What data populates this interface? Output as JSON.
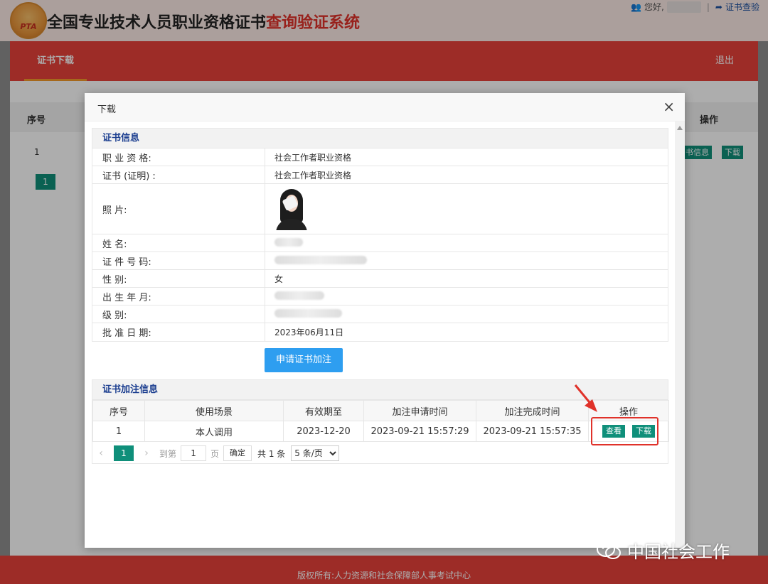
{
  "header": {
    "logo_text": "PTA",
    "title_main": "全国专业技术人员职业资格证书",
    "title_accent": "查询验证系统",
    "greeting": "您好,",
    "sep": "|",
    "verify_link": "证书查验"
  },
  "nav": {
    "active_item": "证书下载",
    "logout": "退出"
  },
  "background_table": {
    "headers": [
      "序号",
      "操作"
    ],
    "row": {
      "index": "1",
      "btn_info": "书信息",
      "btn_download": "下载"
    },
    "pager": {
      "current": "1"
    }
  },
  "modal": {
    "title": "下载",
    "close": "×",
    "cert_section": {
      "heading": "证书信息",
      "rows": [
        {
          "label": "职 业 资 格:",
          "value": "社会工作者职业资格"
        },
        {
          "label": "证书 (证明) :",
          "value": "社会工作者职业资格"
        },
        {
          "label": "照          片:",
          "value": ""
        },
        {
          "label": "姓          名:",
          "value": ""
        },
        {
          "label": "证 件 号 码:",
          "value": ""
        },
        {
          "label": "性          别:",
          "value": "女"
        },
        {
          "label": "出 生 年 月:",
          "value": ""
        },
        {
          "label": "级          别:",
          "value": ""
        },
        {
          "label": "批 准 日 期:",
          "value": "2023年06月11日"
        }
      ]
    },
    "apply_button": "申请证书加注",
    "annotation_section": {
      "heading": "证书加注信息",
      "columns": [
        "序号",
        "使用场景",
        "有效期至",
        "加注申请时间",
        "加注完成时间",
        "操作"
      ],
      "rows": [
        {
          "index": "1",
          "scene": "本人调用",
          "valid_until": "2023-12-20",
          "applied": "2023-09-21 15:57:29",
          "completed": "2023-09-21 15:57:35",
          "btn_view": "查看",
          "btn_download": "下载"
        }
      ],
      "pager": {
        "current": "1",
        "goto_label": "到第",
        "goto_value": "1",
        "page_label": "页",
        "confirm": "确定",
        "total": "共 1 条",
        "page_size": "5 条/页"
      }
    }
  },
  "footer": {
    "copyright": "版权所有:人力资源和社会保障部人事考试中心"
  },
  "watermark": {
    "text": "中国社会工作"
  },
  "colors": {
    "brand_red": "#e8413a",
    "teal": "#0f8f7a",
    "primary_blue": "#2e9ef0",
    "heading_blue": "#1a3d8f"
  }
}
